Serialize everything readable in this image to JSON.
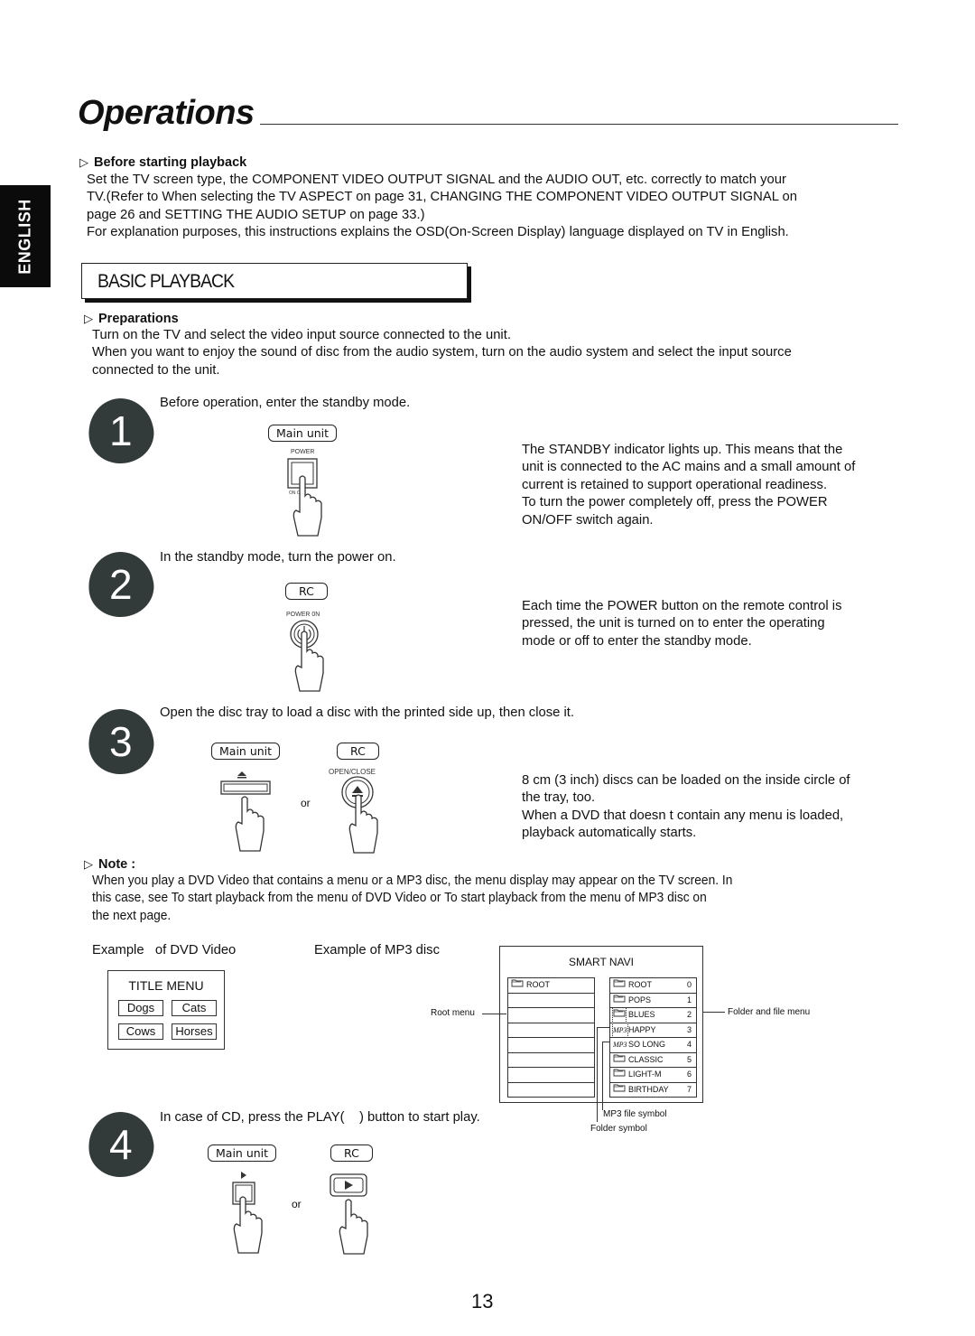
{
  "page": {
    "title": "Operations",
    "language_tab": "ENGLISH",
    "page_number": "13"
  },
  "before_playback": {
    "heading": "Before starting playback",
    "lines": [
      "Set the TV screen type, the COMPONENT VIDEO OUTPUT SIGNAL and the AUDIO OUT, etc. correctly to match your",
      "TV.(Refer to  When selecting the TV ASPECT  on page 31,  CHANGING THE COMPONENT VIDEO OUTPUT SIGNAL  on",
      "page 26 and  SETTING THE AUDIO SETUP  on page 33.)",
      "For explanation purposes, this instructions explains the OSD(On-Screen Display) language displayed on TV in English."
    ]
  },
  "section": {
    "title": "BASIC PLAYBACK"
  },
  "preparations": {
    "heading": "Preparations",
    "lines": [
      "Turn on the TV and select the video input source connected to the unit.",
      "When you want to enjoy the sound of disc from the audio system, turn on the audio system and select the input source",
      "connected to the unit."
    ]
  },
  "steps": [
    {
      "number": "1",
      "instruction": "Before operation, enter the standby mode.",
      "device_labels": [
        "Main unit"
      ],
      "button_caption": "POWER",
      "switch_caption": "ON  OFF",
      "notes": [
        "The STANDBY indicator lights up. This means that the",
        "unit is connected to the AC mains and a small amount of",
        "current is retained to support operational readiness.",
        "To turn the power completely off, press the POWER",
        "ON/OFF switch again."
      ]
    },
    {
      "number": "2",
      "instruction": "In the standby mode, turn the power on.",
      "device_labels": [
        "RC"
      ],
      "button_caption": "POWER 0N",
      "notes": [
        "Each time the POWER button on the remote control is",
        "pressed, the unit is turned on to enter the operating",
        "mode or off to enter the standby mode."
      ]
    },
    {
      "number": "3",
      "instruction": "Open the disc tray to load a disc with the printed side up, then close it.",
      "device_labels": [
        "Main unit",
        "RC"
      ],
      "button_caption": "OPEN/CLOSE",
      "or_label": "or",
      "notes": [
        "8 cm (3 inch) discs can be loaded on the inside circle of",
        "the tray, too.",
        "When a DVD that doesn t contain any menu is loaded,",
        "playback automatically starts."
      ]
    },
    {
      "number": "4",
      "instruction": "In case of CD, press the PLAY(    ) button to start play.",
      "device_labels": [
        "Main unit",
        "RC"
      ],
      "or_label": "or"
    }
  ],
  "note": {
    "heading": "Note :",
    "lines": [
      "When you play a DVD Video that contains a menu or a MP3 disc, the menu display may appear on the TV screen. In",
      "this case, see  To start playback from the menu of DVD Video  or  To start playback from the menu of MP3 disc  on",
      "the next page."
    ]
  },
  "dvd_example": {
    "caption": "Example   of DVD Video",
    "menu_title": "TITLE MENU",
    "buttons": [
      "Dogs",
      "Cats",
      "Cows",
      "Horses"
    ]
  },
  "mp3_example": {
    "caption": "Example of MP3 disc",
    "screen_title": "SMART NAVI",
    "root_menu": [
      {
        "icon": "folder",
        "name": "ROOT"
      },
      {
        "icon": "",
        "name": ""
      },
      {
        "icon": "",
        "name": ""
      },
      {
        "icon": "",
        "name": ""
      },
      {
        "icon": "",
        "name": ""
      },
      {
        "icon": "",
        "name": ""
      },
      {
        "icon": "",
        "name": ""
      },
      {
        "icon": "",
        "name": ""
      }
    ],
    "file_menu": [
      {
        "icon": "folder",
        "name": "ROOT",
        "index": "0"
      },
      {
        "icon": "folder",
        "name": "POPS",
        "index": "1"
      },
      {
        "icon": "folder",
        "name": "BLUES",
        "index": "2"
      },
      {
        "icon": "mp3",
        "name": "HAPPY",
        "index": "3"
      },
      {
        "icon": "mp3",
        "name": "SO LONG",
        "index": "4"
      },
      {
        "icon": "folder",
        "name": "CLASSIC",
        "index": "5"
      },
      {
        "icon": "folder",
        "name": "LIGHT-M",
        "index": "6"
      },
      {
        "icon": "folder",
        "name": "BIRTHDAY",
        "index": "7"
      }
    ],
    "callouts": {
      "root_menu": "Root menu",
      "folder_file_menu": "Folder and file menu",
      "mp3_symbol": "MP3 file symbol",
      "folder_symbol": "Folder symbol"
    },
    "mp3_glyph": "MP3"
  }
}
